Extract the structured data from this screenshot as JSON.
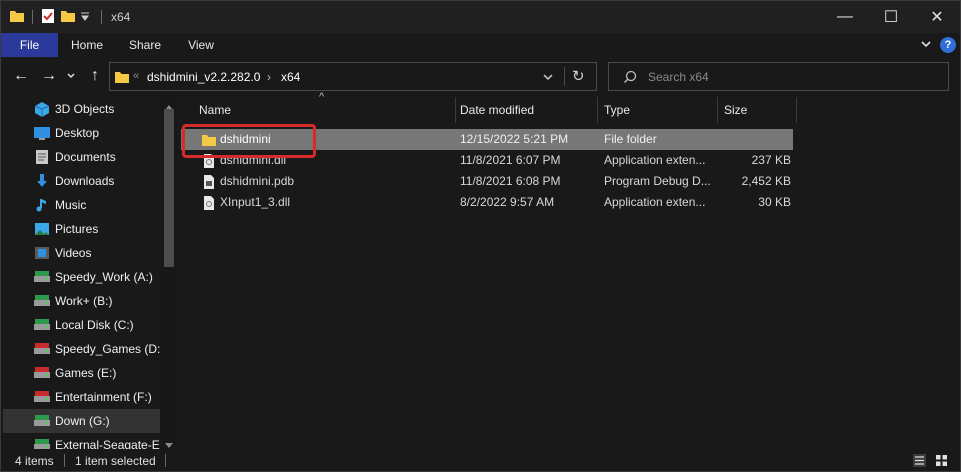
{
  "titlebar": {
    "title": "x64",
    "qat_icons": [
      "folder-icon",
      "properties-icon",
      "new-folder-icon",
      "customize-qat-icon"
    ],
    "minimize": "—",
    "maximize": "☐",
    "close": "✕"
  },
  "ribbon": {
    "tabs": [
      {
        "label": "File"
      },
      {
        "label": "Home"
      },
      {
        "label": "Share"
      },
      {
        "label": "View"
      }
    ],
    "expand_icon": "chevron-down-icon",
    "help_icon": "?"
  },
  "nav": {
    "back": "←",
    "forward": "→",
    "recent": "⌄",
    "up": "↑",
    "breadcrumb": [
      "dshidmini_v2.2.282.0",
      "x64"
    ],
    "overflow": "«",
    "separator": "›",
    "refresh": "↻",
    "search_placeholder": "Search x64"
  },
  "sidebar": {
    "items": [
      {
        "label": "3D Objects",
        "icon": "3d-objects-icon"
      },
      {
        "label": "Desktop",
        "icon": "desktop-icon"
      },
      {
        "label": "Documents",
        "icon": "documents-icon"
      },
      {
        "label": "Downloads",
        "icon": "downloads-icon"
      },
      {
        "label": "Music",
        "icon": "music-icon"
      },
      {
        "label": "Pictures",
        "icon": "pictures-icon"
      },
      {
        "label": "Videos",
        "icon": "videos-icon"
      },
      {
        "label": "Speedy_Work (A:)",
        "icon": "drive-icon"
      },
      {
        "label": "Work+ (B:)",
        "icon": "drive-icon"
      },
      {
        "label": "Local Disk (C:)",
        "icon": "drive-icon"
      },
      {
        "label": "Speedy_Games (D:)",
        "icon": "drive-icon"
      },
      {
        "label": "Games (E:)",
        "icon": "drive-icon"
      },
      {
        "label": "Entertainment (F:)",
        "icon": "drive-icon"
      },
      {
        "label": "Down (G:)",
        "icon": "drive-icon",
        "selected": true
      },
      {
        "label": "External-Seagate-EN",
        "icon": "drive-icon"
      }
    ]
  },
  "columns": {
    "name": "Name",
    "date": "Date modified",
    "type": "Type",
    "size": "Size",
    "sort_indicator": "^"
  },
  "files": [
    {
      "name": "dshidmini",
      "date": "12/15/2022 5:21 PM",
      "type": "File folder",
      "size": "",
      "icon": "folder-icon",
      "selected": true
    },
    {
      "name": "dshidmini.dll",
      "date": "11/8/2021 6:07 PM",
      "type": "Application exten...",
      "size": "237 KB",
      "icon": "dll-file-icon"
    },
    {
      "name": "dshidmini.pdb",
      "date": "11/8/2021 6:08 PM",
      "type": "Program Debug D...",
      "size": "2,452 KB",
      "icon": "pdb-file-icon"
    },
    {
      "name": "XInput1_3.dll",
      "date": "8/2/2022 9:57 AM",
      "type": "Application exten...",
      "size": "30 KB",
      "icon": "dll-file-icon"
    }
  ],
  "status": {
    "item_count": "4 items",
    "selection": "1 item selected"
  },
  "colors": {
    "accent": "#2b3a9a",
    "background": "#191919",
    "highlight_box": "#d62b2b",
    "folder": "#f5c945"
  }
}
